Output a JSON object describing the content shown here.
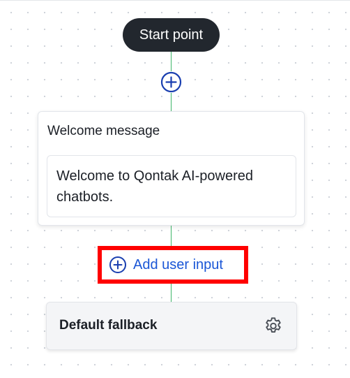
{
  "flow": {
    "start_label": "Start point",
    "welcome": {
      "title": "Welcome message",
      "body": "Welcome to Qontak AI-powered chatbots."
    },
    "add_user_input_label": "Add user input",
    "fallback": {
      "title": "Default fallback"
    }
  },
  "icons": {
    "add_node": "plus-circle-icon",
    "add_user_input": "plus-circle-icon",
    "settings": "gear-icon"
  },
  "colors": {
    "start_pill_bg": "#22272e",
    "accent_blue": "#1a56d6",
    "connector_green": "#3fb56a",
    "highlight_red": "#ff0000",
    "fallback_card_bg": "#f4f5f7"
  }
}
